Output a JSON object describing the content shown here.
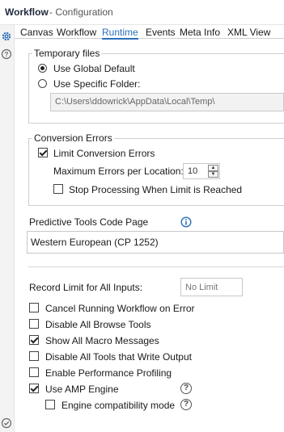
{
  "header": {
    "title": "Workflow",
    "subtitle": "- Configuration"
  },
  "tabs": [
    {
      "label": "Canvas"
    },
    {
      "label": "Workflow"
    },
    {
      "label": "Runtime"
    },
    {
      "label": "Events"
    },
    {
      "label": "Meta Info"
    },
    {
      "label": "XML View"
    }
  ],
  "active_tab": "Runtime",
  "temp_files": {
    "legend": "Temporary files",
    "option_global": "Use Global Default",
    "option_specific": "Use Specific Folder:",
    "selected": "Use Global Default",
    "folder_path": "C:\\Users\\ddowrick\\AppData\\Local\\Temp\\"
  },
  "conversion_errors": {
    "legend": "Conversion Errors",
    "limit_label": "Limit Conversion Errors",
    "limit_checked": true,
    "max_label": "Maximum Errors per Location:",
    "max_value": "10",
    "stop_label": "Stop Processing When Limit is Reached",
    "stop_checked": false
  },
  "predictive": {
    "label": "Predictive Tools Code Page",
    "value": "Western European (CP 1252)",
    "info_icon": "info-icon"
  },
  "record_limit": {
    "label": "Record Limit for All Inputs:",
    "placeholder": "No Limit"
  },
  "options": [
    {
      "label": "Cancel Running Workflow on Error",
      "checked": false
    },
    {
      "label": "Disable All Browse Tools",
      "checked": false
    },
    {
      "label": "Show All Macro Messages",
      "checked": true
    },
    {
      "label": "Disable All Tools that Write Output",
      "checked": false
    },
    {
      "label": "Enable Performance Profiling",
      "checked": false
    },
    {
      "label": "Use AMP Engine",
      "checked": true
    },
    {
      "label": "Engine compatibility mode",
      "checked": false
    }
  ],
  "colors": {
    "accent": "#2a6fb7",
    "rail": "#f3f3f3",
    "border": "#cfcfcf"
  }
}
